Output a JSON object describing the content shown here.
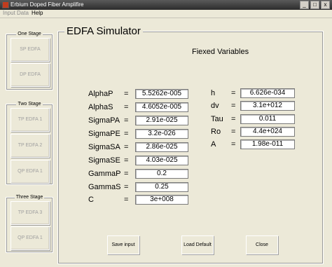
{
  "window": {
    "title": "Erbium Doped Fiber Amplifire",
    "btn_min": "_",
    "btn_max": "□",
    "btn_close": "x"
  },
  "menu": [
    "Input Data",
    "Help"
  ],
  "stages": [
    {
      "title": "One Stage",
      "buttons": [
        "SP EDFA",
        "DP EDFA"
      ]
    },
    {
      "title": "Two Stage",
      "buttons": [
        "TP EDFA 1",
        "TP EDFA 2",
        "QP EDFA 1"
      ]
    },
    {
      "title": "Three Stage",
      "buttons": [
        "TP EDFA 3",
        "QP EDFA 1"
      ]
    }
  ],
  "main": {
    "title": "EDFA Simulator",
    "fixed_vars_label": "Fiexed Variables"
  },
  "vars_left": [
    {
      "label": "AlphaP",
      "value": "5.5262e-005"
    },
    {
      "label": "AlphaS",
      "value": "4.6052e-005"
    },
    {
      "label": "SigmaPA",
      "value": "2.91e-025"
    },
    {
      "label": "SigmaPE",
      "value": "3.2e-026"
    },
    {
      "label": "SigmaSA",
      "value": "2.86e-025"
    },
    {
      "label": "SigmaSE",
      "value": "4.03e-025"
    },
    {
      "label": "GammaP",
      "value": "0.2"
    },
    {
      "label": "GammaS",
      "value": "0.25"
    },
    {
      "label": "C",
      "value": "3e+008"
    }
  ],
  "vars_right": [
    {
      "label": "h",
      "value": "6.626e-034"
    },
    {
      "label": "dv",
      "value": "3.1e+012"
    },
    {
      "label": "Tau",
      "value": "0.011"
    },
    {
      "label": "Ro",
      "value": "4.4e+024"
    },
    {
      "label": "A",
      "value": "1.98e-011"
    }
  ],
  "eq_sign": "=",
  "actions": {
    "save": "Save input",
    "load": "Load Default",
    "close": "Close"
  }
}
